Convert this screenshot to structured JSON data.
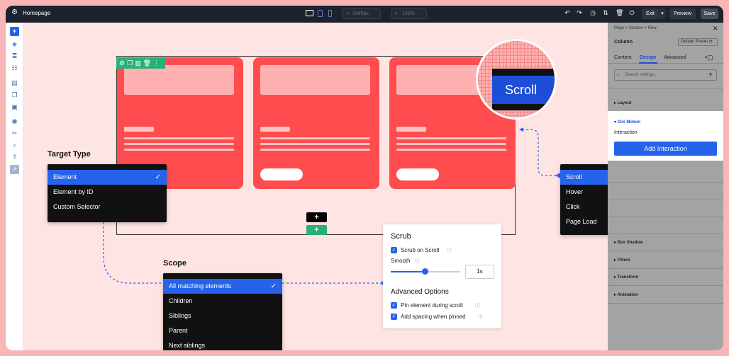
{
  "topbar": {
    "page_title": "Homepage",
    "width_value": "2485px",
    "zoom_value": "100%",
    "exit_label": "Exit",
    "preview_label": "Preview",
    "save_label": "Save"
  },
  "canvas": {
    "zoom_label": "Scroll",
    "target_type": {
      "heading": "Target Type",
      "options": [
        "Element",
        "Element by ID",
        "Custom Selector"
      ],
      "selected": "Element"
    },
    "scope": {
      "heading": "Scope",
      "options": [
        "All matching elements",
        "Children",
        "Siblings",
        "Parent",
        "Next siblings"
      ],
      "selected": "All matching elements"
    },
    "trigger": {
      "options": [
        "Scroll",
        "Hover",
        "Click",
        "Page Load"
      ],
      "selected": "Scroll"
    },
    "scrub": {
      "title": "Scrub",
      "scrub_on_scroll": "Scrub on Scroll",
      "smooth_label": "Smooth",
      "smooth_value": "1s",
      "smooth_fraction": 0.45,
      "advanced_title": "Advanced Options",
      "pin_label": "Pin element during scroll",
      "spacing_label": "Add spacing when pinned"
    }
  },
  "panel": {
    "breadcrumb": "Page > Section > Row",
    "column_label": "Column",
    "preset_label": "Default Preset",
    "tabs": [
      "Content",
      "Design",
      "Advanced"
    ],
    "active_tab": "Design",
    "search_placeholder": "Search settings...",
    "sections": [
      "Layout",
      "Divi Motion",
      "Box Shadow",
      "Filters",
      "Transform",
      "Animation"
    ],
    "interaction_label": "Interaction",
    "add_interaction_label": "Add Interaction"
  },
  "colors": {
    "accent": "#2563eb",
    "card_red": "#ff4d4f",
    "row_green": "#29b07a",
    "topbar": "#1d222c"
  }
}
